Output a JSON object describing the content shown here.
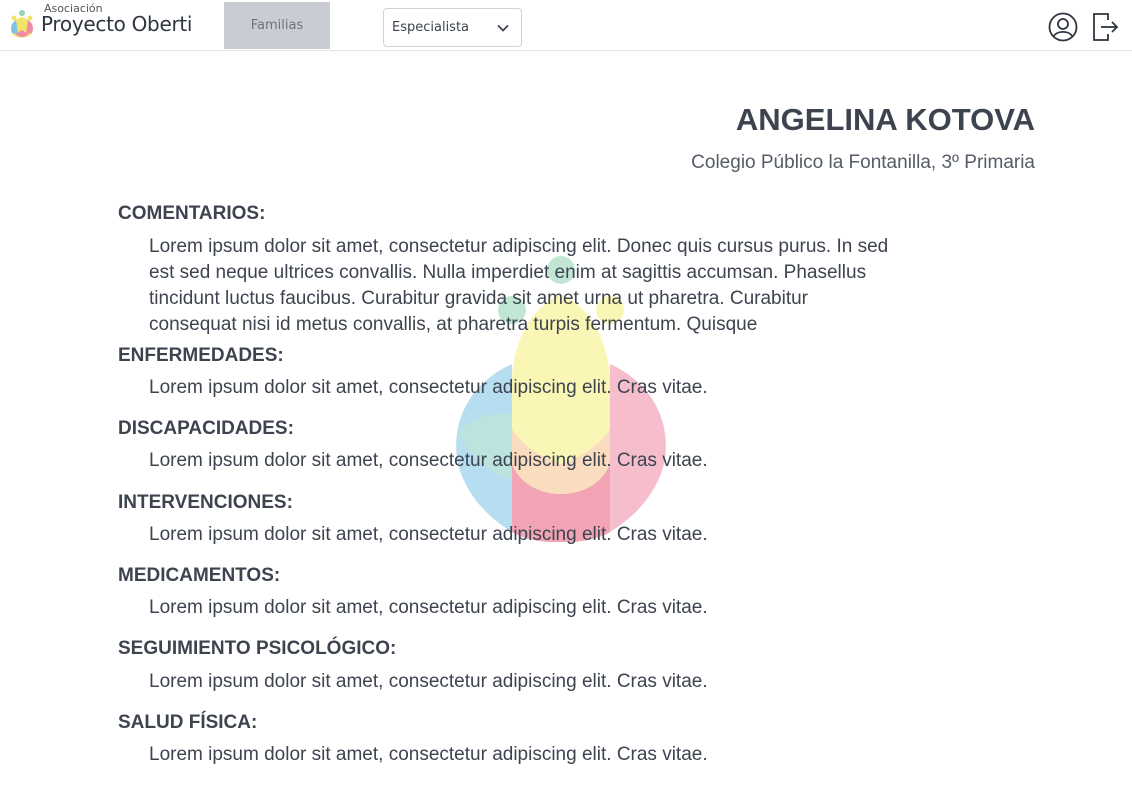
{
  "header": {
    "logo_small": "Asociación",
    "logo_big": "Proyecto Oberti",
    "nav_tab": "Familias",
    "role_select": {
      "value": "Especialista"
    },
    "icons": {
      "user": "user-circle-icon",
      "logout": "logout-icon"
    }
  },
  "profile": {
    "name": "ANGELINA KOTOVA",
    "school": "Colegio Público la Fontanilla, 3º Primaria"
  },
  "sections": {
    "comentarios": {
      "title": "COMENTARIOS:",
      "text": "Lorem ipsum dolor sit amet, consectetur adipiscing elit. Donec quis cursus purus. In sed est sed neque ultrices convallis. Nulla imperdiet enim at sagittis accumsan. Phasellus tincidunt luctus faucibus. Curabitur gravida sit amet urna ut pharetra. Curabitur consequat nisi id metus convallis, at pharetra turpis fermentum. Quisque"
    },
    "enfermedades": {
      "title": "ENFERMEDADES:",
      "text": "Lorem ipsum dolor sit amet, consectetur adipiscing elit. Cras vitae."
    },
    "discapacidades": {
      "title": "DISCAPACIDADES:",
      "text": "Lorem ipsum dolor sit amet, consectetur adipiscing elit. Cras vitae."
    },
    "intervenciones": {
      "title": "INTERVENCIONES:",
      "text": "Lorem ipsum dolor sit amet, consectetur adipiscing elit. Cras vitae."
    },
    "medicamentos": {
      "title": "MEDICAMENTOS:",
      "text": "Lorem ipsum dolor sit amet, consectetur adipiscing elit. Cras vitae."
    },
    "seguimiento": {
      "title": "SEGUIMIENTO PSICOLÓGICO:",
      "text": "Lorem ipsum dolor sit amet, consectetur adipiscing elit. Cras vitae."
    },
    "salud": {
      "title": "SALUD FÍSICA:",
      "text": "Lorem ipsum dolor sit amet, consectetur adipiscing elit. Cras vitae."
    }
  },
  "colors": {
    "text": "#3d4450",
    "tab_active_bg": "#c9cdd3",
    "watermark_yellow": "#f6f07a",
    "watermark_blue": "#7ec3e6",
    "watermark_pink": "#f08aa5",
    "watermark_green": "#8fd3b0"
  }
}
